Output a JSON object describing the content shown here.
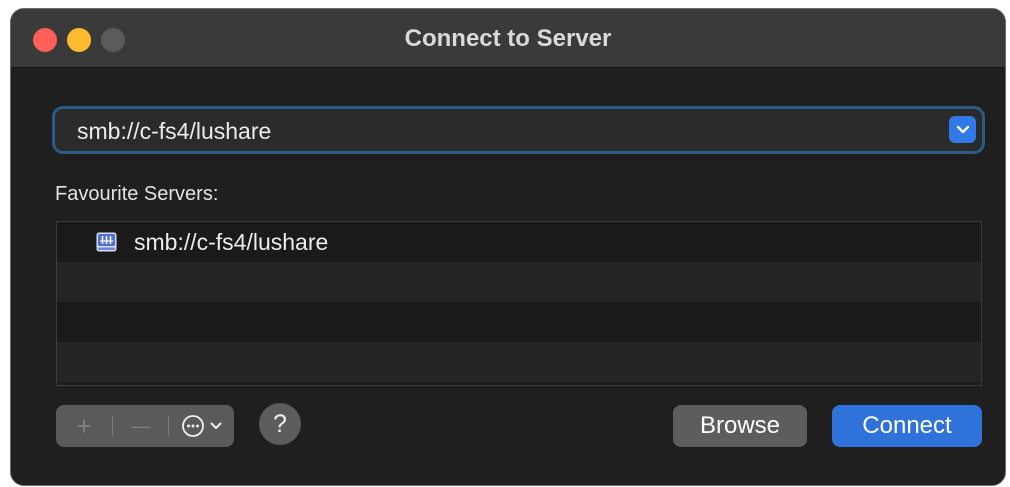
{
  "window": {
    "title": "Connect to Server"
  },
  "address": {
    "value": "smb://c-fs4/lushare"
  },
  "favourites": {
    "label": "Favourite Servers:",
    "items": [
      {
        "label": "smb://c-fs4/lushare",
        "icon": "network-server-icon"
      }
    ]
  },
  "toolbar": {
    "add_label": "+",
    "remove_label": "—",
    "help_label": "?"
  },
  "buttons": {
    "browse": "Browse",
    "connect": "Connect"
  },
  "colors": {
    "accent": "#2f73da",
    "close": "#fe5f57",
    "minimize": "#febc2e",
    "zoom_disabled": "#5b5b5d"
  }
}
